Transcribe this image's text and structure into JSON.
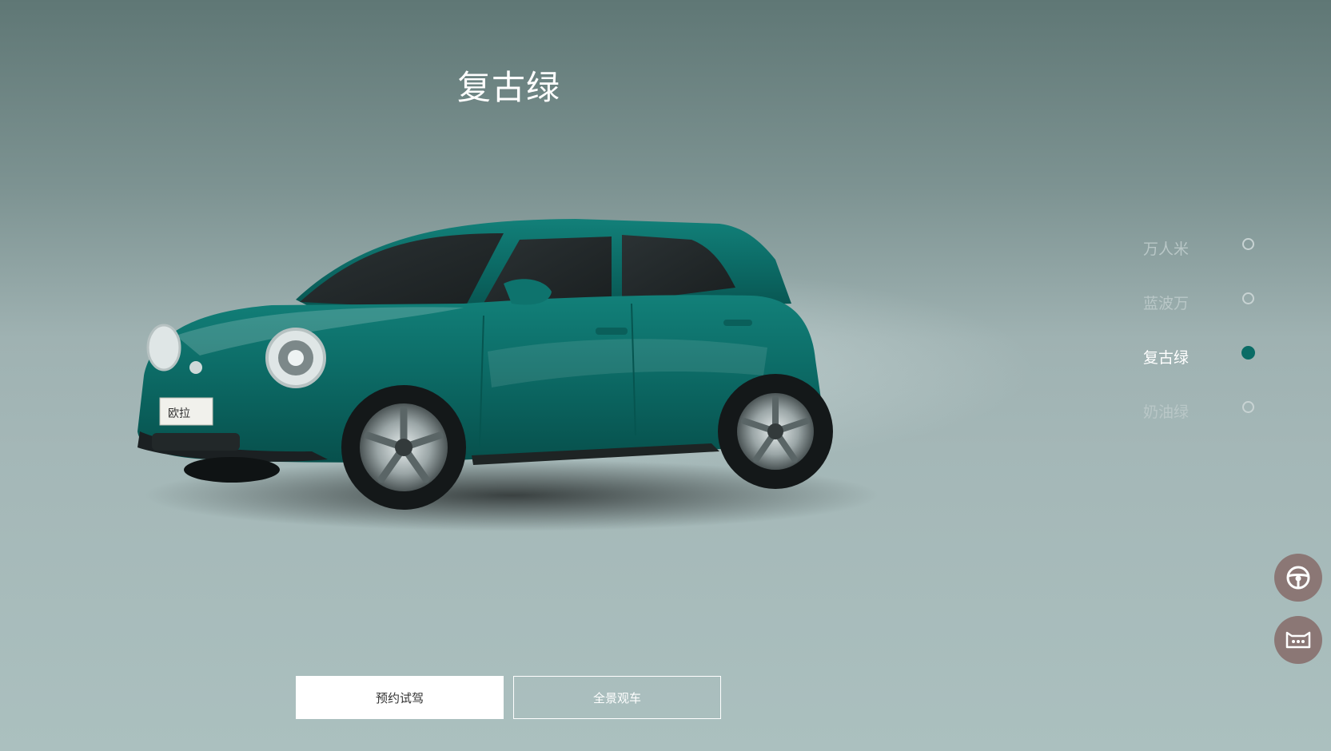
{
  "hero": {
    "selected_color_title": "复古绿",
    "badge_text": "欧拉"
  },
  "color_options": [
    {
      "label": "万人米",
      "selected": false
    },
    {
      "label": "蓝波万",
      "selected": false
    },
    {
      "label": "复古绿",
      "selected": true
    },
    {
      "label": "奶油绿",
      "selected": false
    }
  ],
  "floating_actions": {
    "steering_icon": "steering-wheel-icon",
    "chat_icon": "chat-bot-icon"
  },
  "cta": {
    "test_drive_label": "预约试驾",
    "panorama_label": "全景观车"
  },
  "colors": {
    "accent": "#0b6c66",
    "car_body": "#0d6e69",
    "float_button": "#8b7775"
  }
}
